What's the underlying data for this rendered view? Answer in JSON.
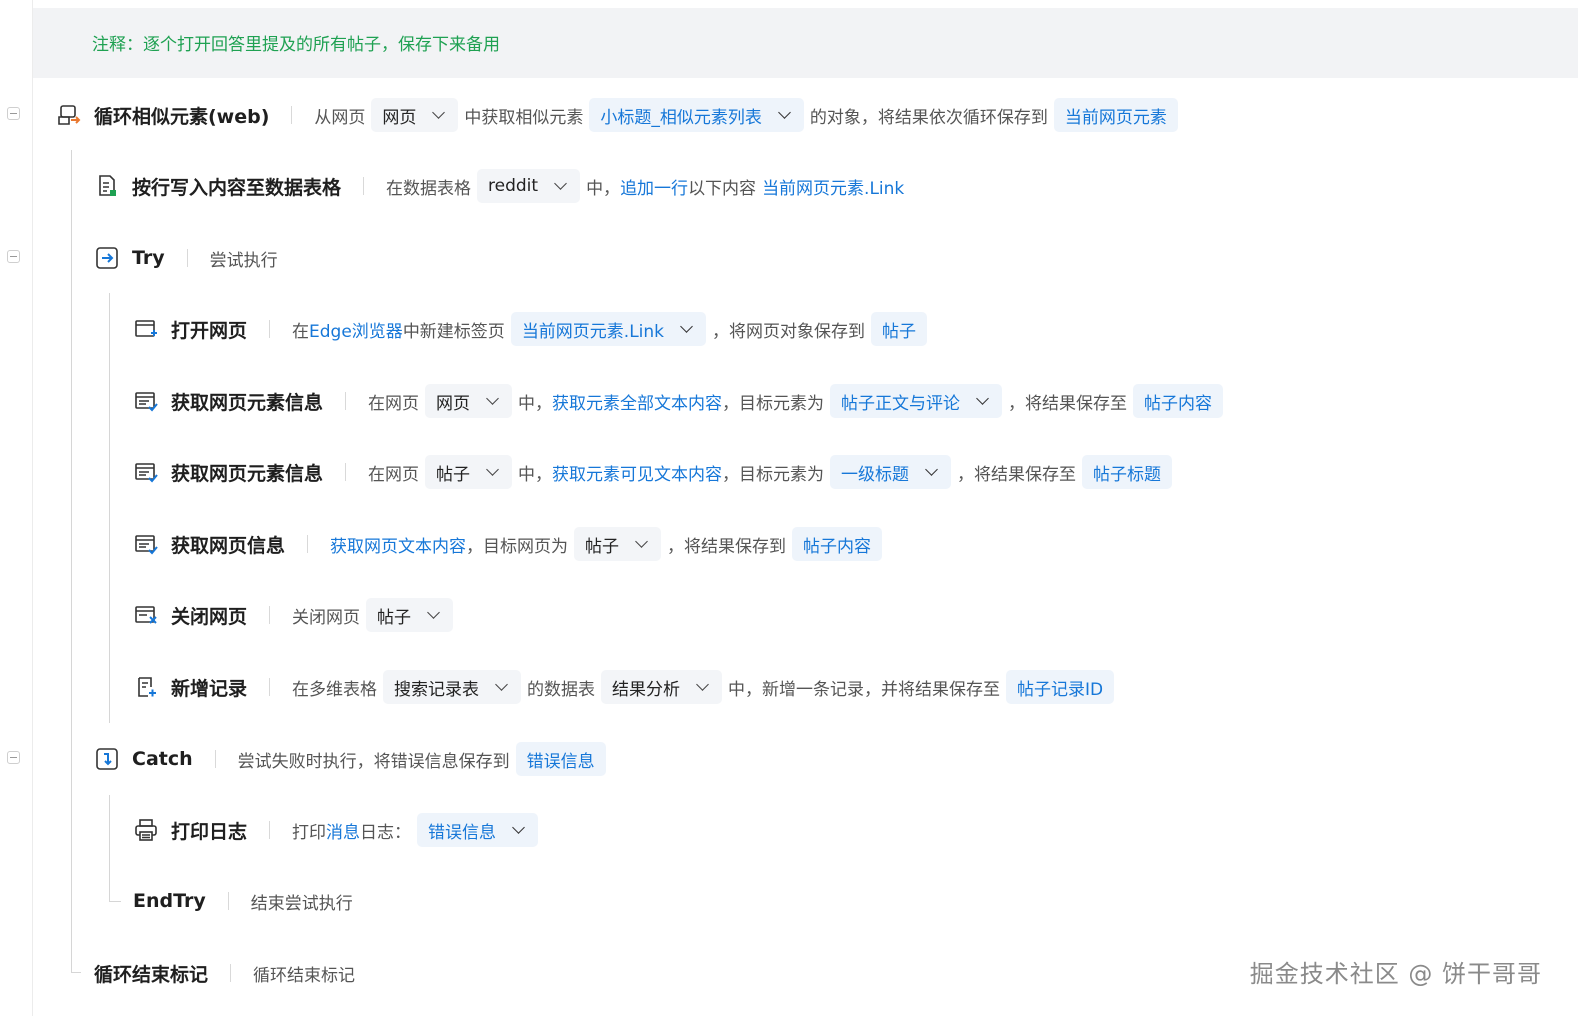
{
  "comment": "注释：逐个打开回答里提及的所有帖子，保存下来备用",
  "rows": {
    "loop": {
      "title": "循环相似元素(web)",
      "t1": "从网页",
      "c1": "网页",
      "t2": "中获取相似元素",
      "c2": "小标题_相似元素列表",
      "t3": "的对象，将结果依次循环保存到",
      "c3": "当前网页元素"
    },
    "write_row": {
      "title": "按行写入内容至数据表格",
      "t1": "在数据表格",
      "c1": "reddit",
      "t2": "中，",
      "l1": "追加一行",
      "t3": "以下内容",
      "l2": "当前网页元素.Link"
    },
    "try": {
      "title": "Try",
      "t1": "尝试执行"
    },
    "open_page": {
      "title": "打开网页",
      "t1": "在",
      "l1": "Edge浏览器",
      "t2": "中新建标签页",
      "c1": "当前网页元素.Link",
      "t3": "，将网页对象保存到",
      "c2": "帖子"
    },
    "get_elem_1": {
      "title": "获取网页元素信息",
      "t1": "在网页",
      "c1": "网页",
      "t2": "中，",
      "l1": "获取元素全部文本内容",
      "t3": "，目标元素为",
      "c2": "帖子正文与评论",
      "t4": "，将结果保存至",
      "c3": "帖子内容"
    },
    "get_elem_2": {
      "title": "获取网页元素信息",
      "t1": "在网页",
      "c1": "帖子",
      "t2": "中，",
      "l1": "获取元素可见文本内容",
      "t3": "，目标元素为",
      "c2": "一级标题",
      "t4": "，将结果保存至",
      "c3": "帖子标题"
    },
    "get_page": {
      "title": "获取网页信息",
      "l1": "获取网页文本内容",
      "t1": "，目标网页为",
      "c1": "帖子",
      "t2": "，将结果保存到",
      "c2": "帖子内容"
    },
    "close_page": {
      "title": "关闭网页",
      "t1": "关闭网页",
      "c1": "帖子"
    },
    "add_record": {
      "title": "新增记录",
      "t1": "在多维表格",
      "c1": "搜索记录表",
      "t2": "的数据表",
      "c2": "结果分析",
      "t3": "中，新增一条记录，并将结果保存至",
      "c3": "帖子记录ID"
    },
    "catch": {
      "title": "Catch",
      "t1": "尝试失败时执行，将错误信息保存到",
      "c1": "错误信息"
    },
    "print_log": {
      "title": "打印日志",
      "t1": "打印",
      "l1": "消息",
      "t2": "日志：",
      "c1": "错误信息"
    },
    "end_try": {
      "title": "EndTry",
      "t1": "结束尝试执行"
    },
    "loop_end": {
      "title": "循环结束标记",
      "t1": "循环结束标记"
    }
  },
  "watermark": "掘金技术社区 @ 饼干哥哥",
  "colors": {
    "link": "#1677d8",
    "comment": "#1fa152",
    "chip_bg": "#f3f5f8"
  },
  "icons": [
    "loop-icon",
    "table-write-icon",
    "try-icon",
    "open-page-icon",
    "page-element-icon",
    "page-info-icon",
    "close-page-icon",
    "add-record-icon",
    "catch-icon",
    "printer-icon"
  ]
}
